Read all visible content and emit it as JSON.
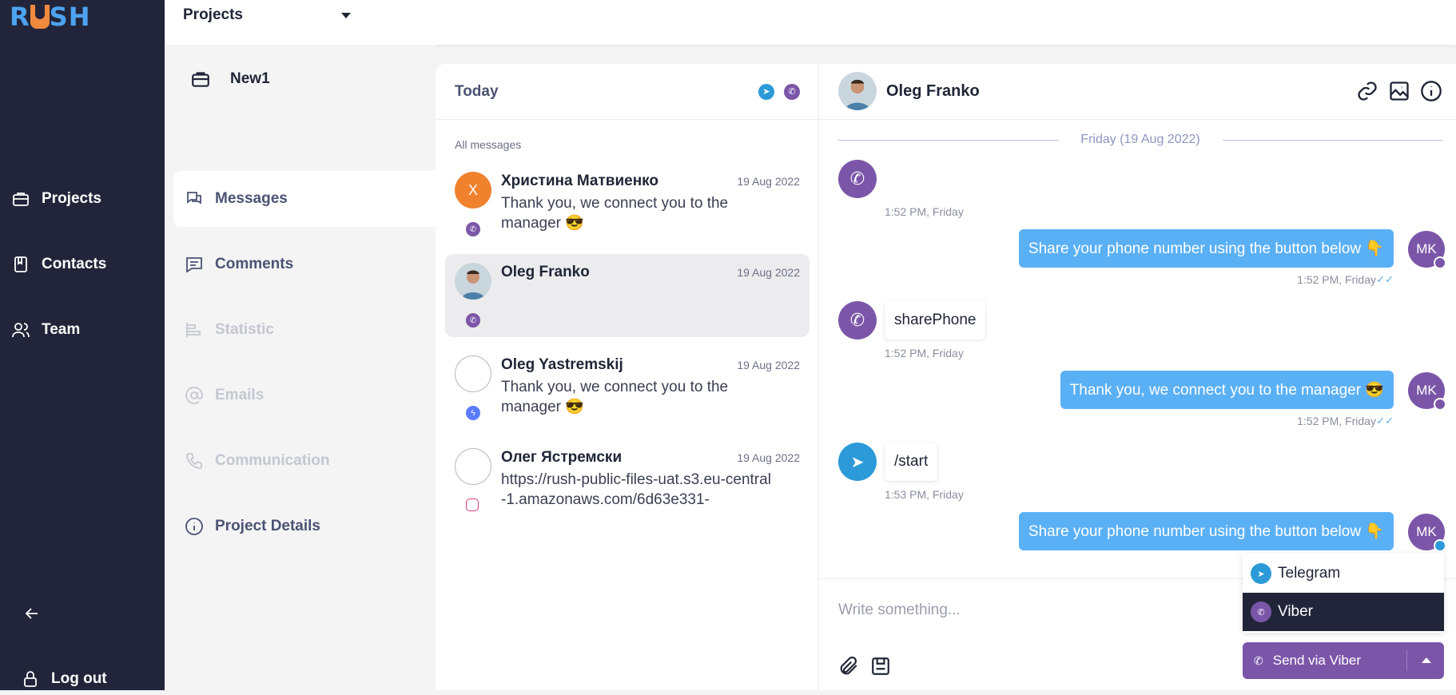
{
  "brand": {
    "logo_text_1": "R",
    "logo_text_2": "SH"
  },
  "sidebar": {
    "items": [
      {
        "label": "Projects",
        "icon": "briefcase-icon"
      },
      {
        "label": "Contacts",
        "icon": "book-icon"
      },
      {
        "label": "Team",
        "icon": "users-icon"
      }
    ],
    "logout": "Log out"
  },
  "topbar": {
    "project_select": "Projects"
  },
  "project": {
    "name": "New1"
  },
  "subnav": {
    "messages": "Messages",
    "comments": "Comments",
    "statistic": "Statistic",
    "emails": "Emails",
    "communication": "Communication",
    "details": "Project Details"
  },
  "list": {
    "header": "Today",
    "section": "All messages",
    "conversations": [
      {
        "initial": "X",
        "name": "Христина Матвиенко",
        "date": "19 Aug 2022",
        "preview": "Thank you, we connect you to the manager 😎",
        "channel": "viber"
      },
      {
        "name": "Oleg Franko",
        "date": "19 Aug 2022",
        "preview": "",
        "channel": "viber"
      },
      {
        "name": "Oleg Yastremskij",
        "date": "19 Aug 2022",
        "preview": "Thank you, we connect you to the manager 😎",
        "channel": "messenger"
      },
      {
        "name": "Олег Ястремски",
        "date": "19 Aug 2022",
        "preview": "https://rush-public-files-uat.s3.eu-central-1.amazonaws.com/6d63e331-",
        "channel": "instagram"
      }
    ]
  },
  "chat": {
    "contact": "Oleg Franko",
    "date_separator": "Friday (19 Aug 2022)",
    "messages": [
      {
        "dir": "in",
        "text": "",
        "time": "1:52 PM, Friday"
      },
      {
        "dir": "out",
        "text": "Share your phone number using the button below 👇",
        "time": "1:52 PM, Friday",
        "avatar": "MK"
      },
      {
        "dir": "in",
        "text": "sharePhone",
        "time": "1:52 PM, Friday"
      },
      {
        "dir": "out",
        "text": "Thank you, we connect you to the manager 😎",
        "time": "1:52 PM, Friday",
        "avatar": "MK"
      },
      {
        "dir": "in",
        "text": "/start",
        "time": "1:53 PM, Friday"
      },
      {
        "dir": "out",
        "text": "Share your phone number using the button below 👇",
        "time": "",
        "avatar": "MK"
      }
    ],
    "composer_placeholder": "Write something...",
    "channel_options": [
      "Telegram",
      "Viber"
    ],
    "send_label": "Send via Viber"
  },
  "colors": {
    "sidebar": "#22253a",
    "accent": "#5ab0f5",
    "viber": "#7b56a8",
    "telegram": "#2c9ad8"
  }
}
